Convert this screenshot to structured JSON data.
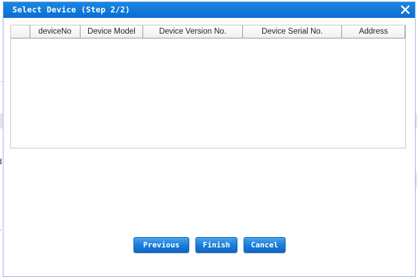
{
  "dialog": {
    "title": "Select Device (Step 2/2)",
    "close_icon": "close-icon"
  },
  "table": {
    "columns": [
      {
        "key": "select",
        "label": ""
      },
      {
        "key": "deviceNo",
        "label": "deviceNo"
      },
      {
        "key": "model",
        "label": "Device Model"
      },
      {
        "key": "version",
        "label": "Device Version No."
      },
      {
        "key": "serial",
        "label": "Device Serial No."
      },
      {
        "key": "address",
        "label": "Address"
      }
    ],
    "rows": []
  },
  "buttons": {
    "previous": "Previous",
    "finish": "Finish",
    "cancel": "Cancel"
  },
  "background": {
    "glyph_left_1": "d",
    "glyph_left_2": "r"
  },
  "colors": {
    "titlebar": "#0b6fd1",
    "button": "#1a7ed9",
    "title_text": "#ffffff"
  }
}
